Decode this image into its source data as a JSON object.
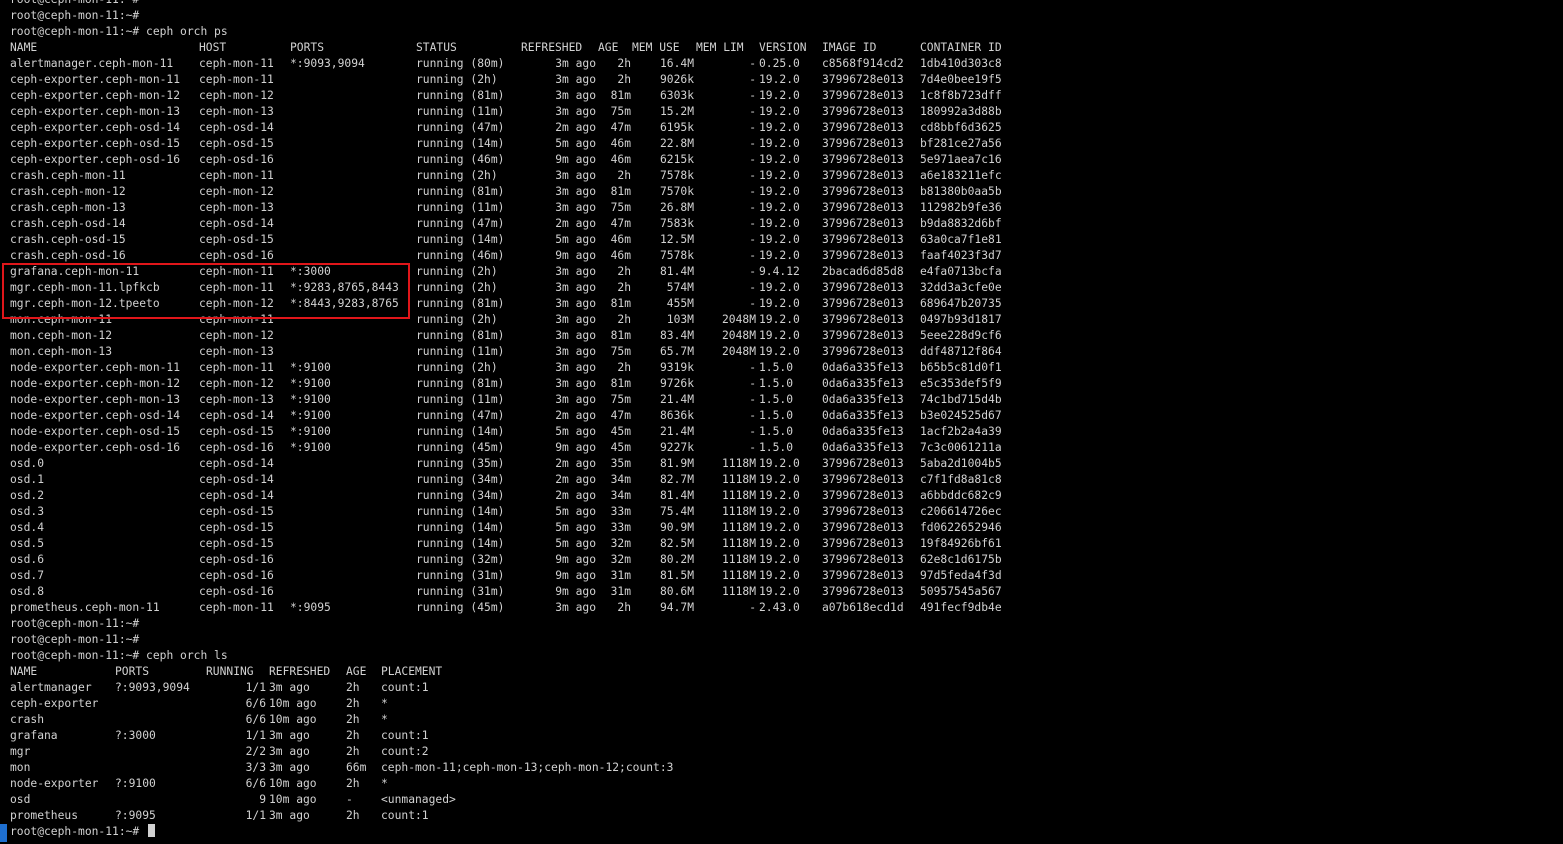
{
  "prompt": "root@ceph-mon-11:~#",
  "commands": {
    "ps": "ceph orch ps",
    "ls": "ceph orch ls"
  },
  "colors": {
    "background": "#000000",
    "text": "#d2d2d2",
    "highlight": "#e0161a",
    "gutter": "#1e6fd0"
  },
  "ps": {
    "headers": [
      "NAME",
      "HOST",
      "PORTS",
      "STATUS",
      "REFRESHED",
      "AGE",
      "MEM USE",
      "MEM LIM",
      "VERSION",
      "IMAGE ID",
      "CONTAINER ID"
    ],
    "rows": [
      [
        "alertmanager.ceph-mon-11",
        "ceph-mon-11",
        "*:9093,9094",
        "running (80m)",
        "3m ago",
        "2h",
        "16.4M",
        "-",
        "0.25.0",
        "c8568f914cd2",
        "1db410d303c8"
      ],
      [
        "ceph-exporter.ceph-mon-11",
        "ceph-mon-11",
        "",
        "running (2h)",
        "3m ago",
        "2h",
        "9026k",
        "-",
        "19.2.0",
        "37996728e013",
        "7d4e0bee19f5"
      ],
      [
        "ceph-exporter.ceph-mon-12",
        "ceph-mon-12",
        "",
        "running (81m)",
        "3m ago",
        "81m",
        "6303k",
        "-",
        "19.2.0",
        "37996728e013",
        "1c8f8b723dff"
      ],
      [
        "ceph-exporter.ceph-mon-13",
        "ceph-mon-13",
        "",
        "running (11m)",
        "3m ago",
        "75m",
        "15.2M",
        "-",
        "19.2.0",
        "37996728e013",
        "180992a3d88b"
      ],
      [
        "ceph-exporter.ceph-osd-14",
        "ceph-osd-14",
        "",
        "running (47m)",
        "2m ago",
        "47m",
        "6195k",
        "-",
        "19.2.0",
        "37996728e013",
        "cd8bbf6d3625"
      ],
      [
        "ceph-exporter.ceph-osd-15",
        "ceph-osd-15",
        "",
        "running (14m)",
        "5m ago",
        "46m",
        "22.8M",
        "-",
        "19.2.0",
        "37996728e013",
        "bf281ce27a56"
      ],
      [
        "ceph-exporter.ceph-osd-16",
        "ceph-osd-16",
        "",
        "running (46m)",
        "9m ago",
        "46m",
        "6215k",
        "-",
        "19.2.0",
        "37996728e013",
        "5e971aea7c16"
      ],
      [
        "crash.ceph-mon-11",
        "ceph-mon-11",
        "",
        "running (2h)",
        "3m ago",
        "2h",
        "7578k",
        "-",
        "19.2.0",
        "37996728e013",
        "a6e183211efc"
      ],
      [
        "crash.ceph-mon-12",
        "ceph-mon-12",
        "",
        "running (81m)",
        "3m ago",
        "81m",
        "7570k",
        "-",
        "19.2.0",
        "37996728e013",
        "b81380b0aa5b"
      ],
      [
        "crash.ceph-mon-13",
        "ceph-mon-13",
        "",
        "running (11m)",
        "3m ago",
        "75m",
        "26.8M",
        "-",
        "19.2.0",
        "37996728e013",
        "112982b9fe36"
      ],
      [
        "crash.ceph-osd-14",
        "ceph-osd-14",
        "",
        "running (47m)",
        "2m ago",
        "47m",
        "7583k",
        "-",
        "19.2.0",
        "37996728e013",
        "b9da8832d6bf"
      ],
      [
        "crash.ceph-osd-15",
        "ceph-osd-15",
        "",
        "running (14m)",
        "5m ago",
        "46m",
        "12.5M",
        "-",
        "19.2.0",
        "37996728e013",
        "63a0ca7f1e81"
      ],
      [
        "crash.ceph-osd-16",
        "ceph-osd-16",
        "",
        "running (46m)",
        "9m ago",
        "46m",
        "7578k",
        "-",
        "19.2.0",
        "37996728e013",
        "faaf4023f3d7"
      ],
      [
        "grafana.ceph-mon-11",
        "ceph-mon-11",
        "*:3000",
        "running (2h)",
        "3m ago",
        "2h",
        "81.4M",
        "-",
        "9.4.12",
        "2bacad6d85d8",
        "e4fa0713bcfa"
      ],
      [
        "mgr.ceph-mon-11.lpfkcb",
        "ceph-mon-11",
        "*:9283,8765,8443",
        "running (2h)",
        "3m ago",
        "2h",
        "574M",
        "-",
        "19.2.0",
        "37996728e013",
        "32dd3a3cfe0e"
      ],
      [
        "mgr.ceph-mon-12.tpeeto",
        "ceph-mon-12",
        "*:8443,9283,8765",
        "running (81m)",
        "3m ago",
        "81m",
        "455M",
        "-",
        "19.2.0",
        "37996728e013",
        "689647b20735"
      ],
      [
        "mon.ceph-mon-11",
        "ceph-mon-11",
        "",
        "running (2h)",
        "3m ago",
        "2h",
        "103M",
        "2048M",
        "19.2.0",
        "37996728e013",
        "0497b93d1817"
      ],
      [
        "mon.ceph-mon-12",
        "ceph-mon-12",
        "",
        "running (81m)",
        "3m ago",
        "81m",
        "83.4M",
        "2048M",
        "19.2.0",
        "37996728e013",
        "5eee228d9cf6"
      ],
      [
        "mon.ceph-mon-13",
        "ceph-mon-13",
        "",
        "running (11m)",
        "3m ago",
        "75m",
        "65.7M",
        "2048M",
        "19.2.0",
        "37996728e013",
        "ddf48712f864"
      ],
      [
        "node-exporter.ceph-mon-11",
        "ceph-mon-11",
        "*:9100",
        "running (2h)",
        "3m ago",
        "2h",
        "9319k",
        "-",
        "1.5.0",
        "0da6a335fe13",
        "b65b5c81d0f1"
      ],
      [
        "node-exporter.ceph-mon-12",
        "ceph-mon-12",
        "*:9100",
        "running (81m)",
        "3m ago",
        "81m",
        "9726k",
        "-",
        "1.5.0",
        "0da6a335fe13",
        "e5c353def5f9"
      ],
      [
        "node-exporter.ceph-mon-13",
        "ceph-mon-13",
        "*:9100",
        "running (11m)",
        "3m ago",
        "75m",
        "21.4M",
        "-",
        "1.5.0",
        "0da6a335fe13",
        "74c1bd715d4b"
      ],
      [
        "node-exporter.ceph-osd-14",
        "ceph-osd-14",
        "*:9100",
        "running (47m)",
        "2m ago",
        "47m",
        "8636k",
        "-",
        "1.5.0",
        "0da6a335fe13",
        "b3e024525d67"
      ],
      [
        "node-exporter.ceph-osd-15",
        "ceph-osd-15",
        "*:9100",
        "running (14m)",
        "5m ago",
        "45m",
        "21.4M",
        "-",
        "1.5.0",
        "0da6a335fe13",
        "1acf2b2a4a39"
      ],
      [
        "node-exporter.ceph-osd-16",
        "ceph-osd-16",
        "*:9100",
        "running (45m)",
        "9m ago",
        "45m",
        "9227k",
        "-",
        "1.5.0",
        "0da6a335fe13",
        "7c3c0061211a"
      ],
      [
        "osd.0",
        "ceph-osd-14",
        "",
        "running (35m)",
        "2m ago",
        "35m",
        "81.9M",
        "1118M",
        "19.2.0",
        "37996728e013",
        "5aba2d1004b5"
      ],
      [
        "osd.1",
        "ceph-osd-14",
        "",
        "running (34m)",
        "2m ago",
        "34m",
        "82.7M",
        "1118M",
        "19.2.0",
        "37996728e013",
        "c7f1fd8a81c8"
      ],
      [
        "osd.2",
        "ceph-osd-14",
        "",
        "running (34m)",
        "2m ago",
        "34m",
        "81.4M",
        "1118M",
        "19.2.0",
        "37996728e013",
        "a6bbddc682c9"
      ],
      [
        "osd.3",
        "ceph-osd-15",
        "",
        "running (14m)",
        "5m ago",
        "33m",
        "75.4M",
        "1118M",
        "19.2.0",
        "37996728e013",
        "c206614726ec"
      ],
      [
        "osd.4",
        "ceph-osd-15",
        "",
        "running (14m)",
        "5m ago",
        "33m",
        "90.9M",
        "1118M",
        "19.2.0",
        "37996728e013",
        "fd0622652946"
      ],
      [
        "osd.5",
        "ceph-osd-15",
        "",
        "running (14m)",
        "5m ago",
        "32m",
        "82.5M",
        "1118M",
        "19.2.0",
        "37996728e013",
        "19f84926bf61"
      ],
      [
        "osd.6",
        "ceph-osd-16",
        "",
        "running (32m)",
        "9m ago",
        "32m",
        "80.2M",
        "1118M",
        "19.2.0",
        "37996728e013",
        "62e8c1d6175b"
      ],
      [
        "osd.7",
        "ceph-osd-16",
        "",
        "running (31m)",
        "9m ago",
        "31m",
        "81.5M",
        "1118M",
        "19.2.0",
        "37996728e013",
        "97d5feda4f3d"
      ],
      [
        "osd.8",
        "ceph-osd-16",
        "",
        "running (31m)",
        "9m ago",
        "31m",
        "80.6M",
        "1118M",
        "19.2.0",
        "37996728e013",
        "50957545a567"
      ],
      [
        "prometheus.ceph-mon-11",
        "ceph-mon-11",
        "*:9095",
        "running (45m)",
        "3m ago",
        "2h",
        "94.7M",
        "-",
        "2.43.0",
        "a07b618ecd1d",
        "491fecf9db4e"
      ]
    ]
  },
  "ls": {
    "headers": [
      "NAME",
      "PORTS",
      "RUNNING",
      "REFRESHED",
      "AGE",
      "PLACEMENT"
    ],
    "rows": [
      [
        "alertmanager",
        "?:9093,9094",
        "1/1",
        "3m ago",
        "2h",
        "count:1"
      ],
      [
        "ceph-exporter",
        "",
        "6/6",
        "10m ago",
        "2h",
        "*"
      ],
      [
        "crash",
        "",
        "6/6",
        "10m ago",
        "2h",
        "*"
      ],
      [
        "grafana",
        "?:3000",
        "1/1",
        "3m ago",
        "2h",
        "count:1"
      ],
      [
        "mgr",
        "",
        "2/2",
        "3m ago",
        "2h",
        "count:2"
      ],
      [
        "mon",
        "",
        "3/3",
        "3m ago",
        "66m",
        "ceph-mon-11;ceph-mon-13;ceph-mon-12;count:3"
      ],
      [
        "node-exporter",
        "?:9100",
        "6/6",
        "10m ago",
        "2h",
        "*"
      ],
      [
        "osd",
        "",
        "9",
        "10m ago",
        "-",
        "<unmanaged>"
      ],
      [
        "prometheus",
        "?:9095",
        "1/1",
        "3m ago",
        "2h",
        "count:1"
      ]
    ]
  }
}
